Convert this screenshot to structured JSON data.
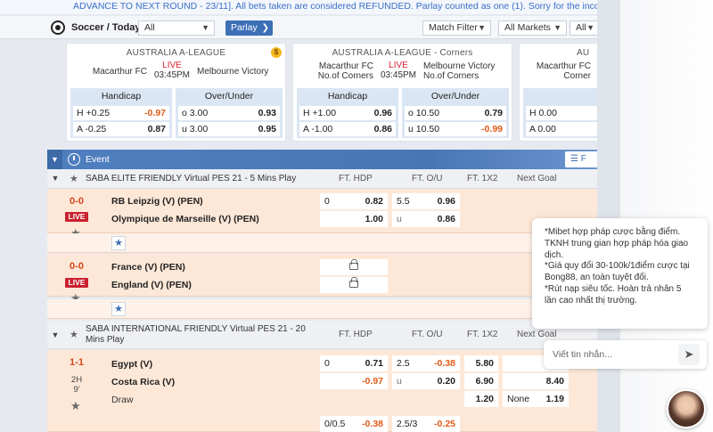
{
  "ticker": "ADVANCE TO NEXT ROUND - 23/11]. All bets taken are considered REFUNDED. Parlay counted as one (1). Sorry for the inconvenience",
  "toolbar": {
    "sport": "Soccer / Today",
    "filter_all": "All",
    "parlay": "Parlay",
    "match_filter": "Match Filter",
    "all_markets": "All Markets",
    "all_short": "All"
  },
  "cards": [
    {
      "league": "AUSTRALIA A-LEAGUE",
      "home": "Macarthur FC",
      "away": "Melbourne Victory",
      "live": "LIVE",
      "time": "03:45PM",
      "handicap_title": "Handicap",
      "ou_title": "Over/Under",
      "hdp": [
        {
          "label": "H +0.25",
          "odds": "-0.97"
        },
        {
          "label": "A -0.25",
          "odds": "0.87"
        }
      ],
      "ou": [
        {
          "label": "o 3.00",
          "odds": "0.93"
        },
        {
          "label": "u 3.00",
          "odds": "0.95"
        }
      ]
    },
    {
      "league": "AUSTRALIA A-LEAGUE - Corners",
      "home": "Macarthur FC No.of Corners",
      "away": "Melbourne Victory No.of Corners",
      "live": "LIVE",
      "time": "03:45PM",
      "handicap_title": "Handicap",
      "ou_title": "Over/Under",
      "hdp": [
        {
          "label": "H +1.00",
          "odds": "0.96"
        },
        {
          "label": "A -1.00",
          "odds": "0.86"
        }
      ],
      "ou": [
        {
          "label": "o 10.50",
          "odds": "0.79"
        },
        {
          "label": "u 10.50",
          "odds": "-0.99"
        }
      ]
    },
    {
      "league": "AU",
      "home": "Macarthur FC Corner",
      "hdp": [
        {
          "label": "H 0.00"
        },
        {
          "label": "A 0.00"
        }
      ]
    }
  ],
  "event_bar": {
    "label": "Event",
    "filter": "☰ F"
  },
  "columns": {
    "hdp": "FT. HDP",
    "ou": "FT. O/U",
    "x12": "FT. 1X2",
    "next_goal": "Next Goal"
  },
  "leagues": [
    {
      "name": "SABA ELITE FRIENDLY Virtual PES 21 - 5 Mins Play",
      "matches": [
        {
          "score": "0-0",
          "badge": "LIVE",
          "home": "RB Leipzig (V) (PEN)",
          "away": "Olympique de Marseille (V) (PEN)",
          "hdp": [
            {
              "line": "0",
              "odds": "0.82"
            },
            {
              "line": "",
              "odds": "1.00"
            }
          ],
          "ou": [
            {
              "line": "5.5",
              "odds": "0.96"
            },
            {
              "line": "u",
              "odds": "0.86"
            }
          ]
        },
        {
          "score": "0-0",
          "badge": "LIVE",
          "home": "France (V) (PEN)",
          "away": "England (V) (PEN)"
        }
      ]
    },
    {
      "name": "SABA INTERNATIONAL FRIENDLY Virtual PES 21 - 20 Mins Play",
      "matches": [
        {
          "score": "1-1",
          "period": "2H",
          "minute": "9'",
          "home": "Egypt (V)",
          "away": "Costa Rica (V)",
          "draw": "Draw",
          "hdp": [
            {
              "line": "0",
              "odds": "0.71"
            },
            {
              "line": "",
              "odds": "-0.97"
            }
          ],
          "ou": [
            {
              "line": "2.5",
              "odds": "-0.38"
            },
            {
              "line": "u",
              "odds": "0.20"
            }
          ],
          "x12": [
            "5.80",
            "6.90",
            "1.20"
          ],
          "next_goal": [
            {
              "line": "",
              "odds": ""
            },
            {
              "line": "",
              "odds": "8.40"
            },
            {
              "line": "None",
              "odds": "1.19"
            }
          ],
          "extra": {
            "hdp_line": "0/0.5",
            "hdp_odds": "-0.38",
            "ou_line": "2.5/3",
            "ou_odds": "-0.25"
          }
        }
      ]
    }
  ],
  "chat": {
    "message": "*Mibet hợp pháp cược bằng điểm. TKNH trung gian hợp pháp hóa giao dịch.\n*Giá quy đổi 30-100k/1điểm cược tại Bong88, an toàn tuyệt đối.\n*Rút nạp siêu tốc. Hoàn trả nhân 5 lần cao nhất thị trường.",
    "placeholder": "Viết tin nhắn..."
  },
  "colors": {
    "accent": "#3d6fb6",
    "live": "#c9212f",
    "negative": "#e05a1a",
    "row": "#fde8d8"
  }
}
